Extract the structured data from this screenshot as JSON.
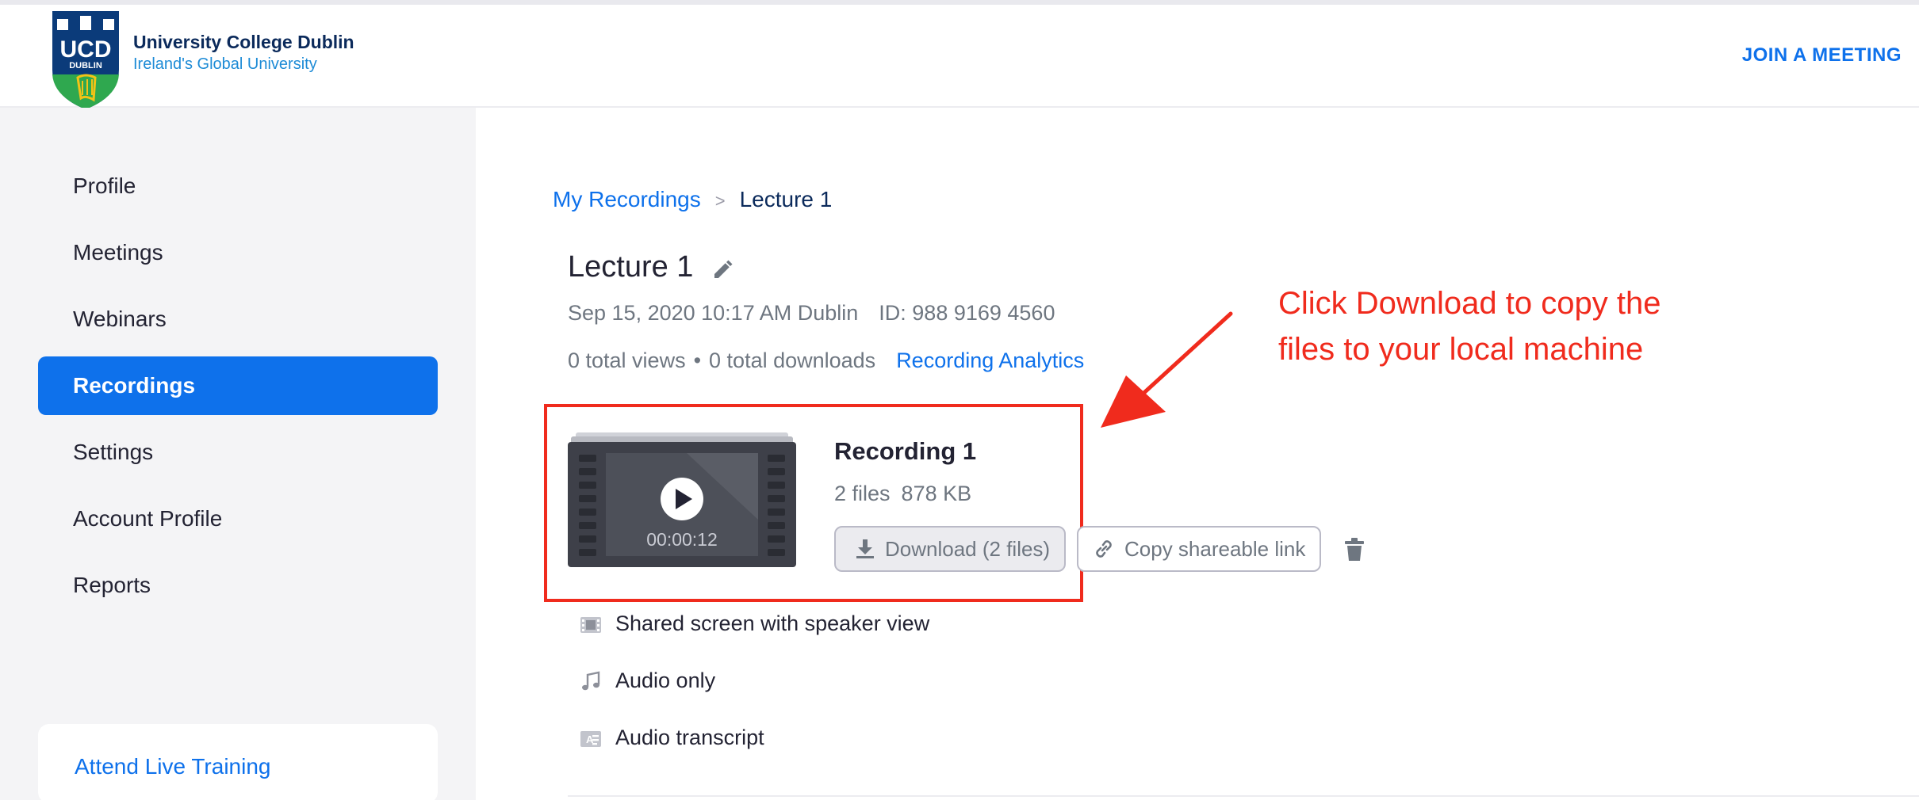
{
  "header": {
    "logo_letters": "UCD",
    "logo_sub": "DUBLIN",
    "org_name": "University College Dublin",
    "org_tagline": "Ireland's Global University",
    "join_link": "JOIN A MEETING"
  },
  "sidebar": {
    "items": [
      {
        "label": "Profile",
        "active": false
      },
      {
        "label": "Meetings",
        "active": false
      },
      {
        "label": "Webinars",
        "active": false
      },
      {
        "label": "Recordings",
        "active": true
      },
      {
        "label": "Settings",
        "active": false
      },
      {
        "label": "Account Profile",
        "active": false
      },
      {
        "label": "Reports",
        "active": false
      }
    ],
    "training_link": "Attend Live Training"
  },
  "breadcrumb": {
    "parent": "My Recordings",
    "separator": ">",
    "current": "Lecture 1"
  },
  "recording": {
    "title": "Lecture 1",
    "datetime": "Sep 15, 2020 10:17 AM Dublin",
    "meeting_id": "ID: 988 9169 4560",
    "views": "0 total views",
    "stats_separator": "•",
    "downloads": "0 total downloads",
    "analytics_link": "Recording Analytics"
  },
  "card": {
    "title": "Recording 1",
    "file_count": "2 files",
    "size": "878 KB",
    "duration": "00:00:12",
    "download_button": "Download (2 files)",
    "copy_button": "Copy shareable link"
  },
  "files": [
    {
      "label": "Shared screen with speaker view",
      "icon": "video-file-icon"
    },
    {
      "label": "Audio only",
      "icon": "music-note-icon"
    },
    {
      "label": "Audio transcript",
      "icon": "transcript-icon"
    }
  ],
  "annotation": {
    "line1": "Click Download to copy the",
    "line2": "files to your local machine"
  },
  "colors": {
    "accent": "#0e71eb",
    "annotation_red": "#f02b1d",
    "sidebar_bg": "#f4f4f6",
    "ucd_navy": "#0b3b7a",
    "ucd_green": "#2fa84f"
  }
}
